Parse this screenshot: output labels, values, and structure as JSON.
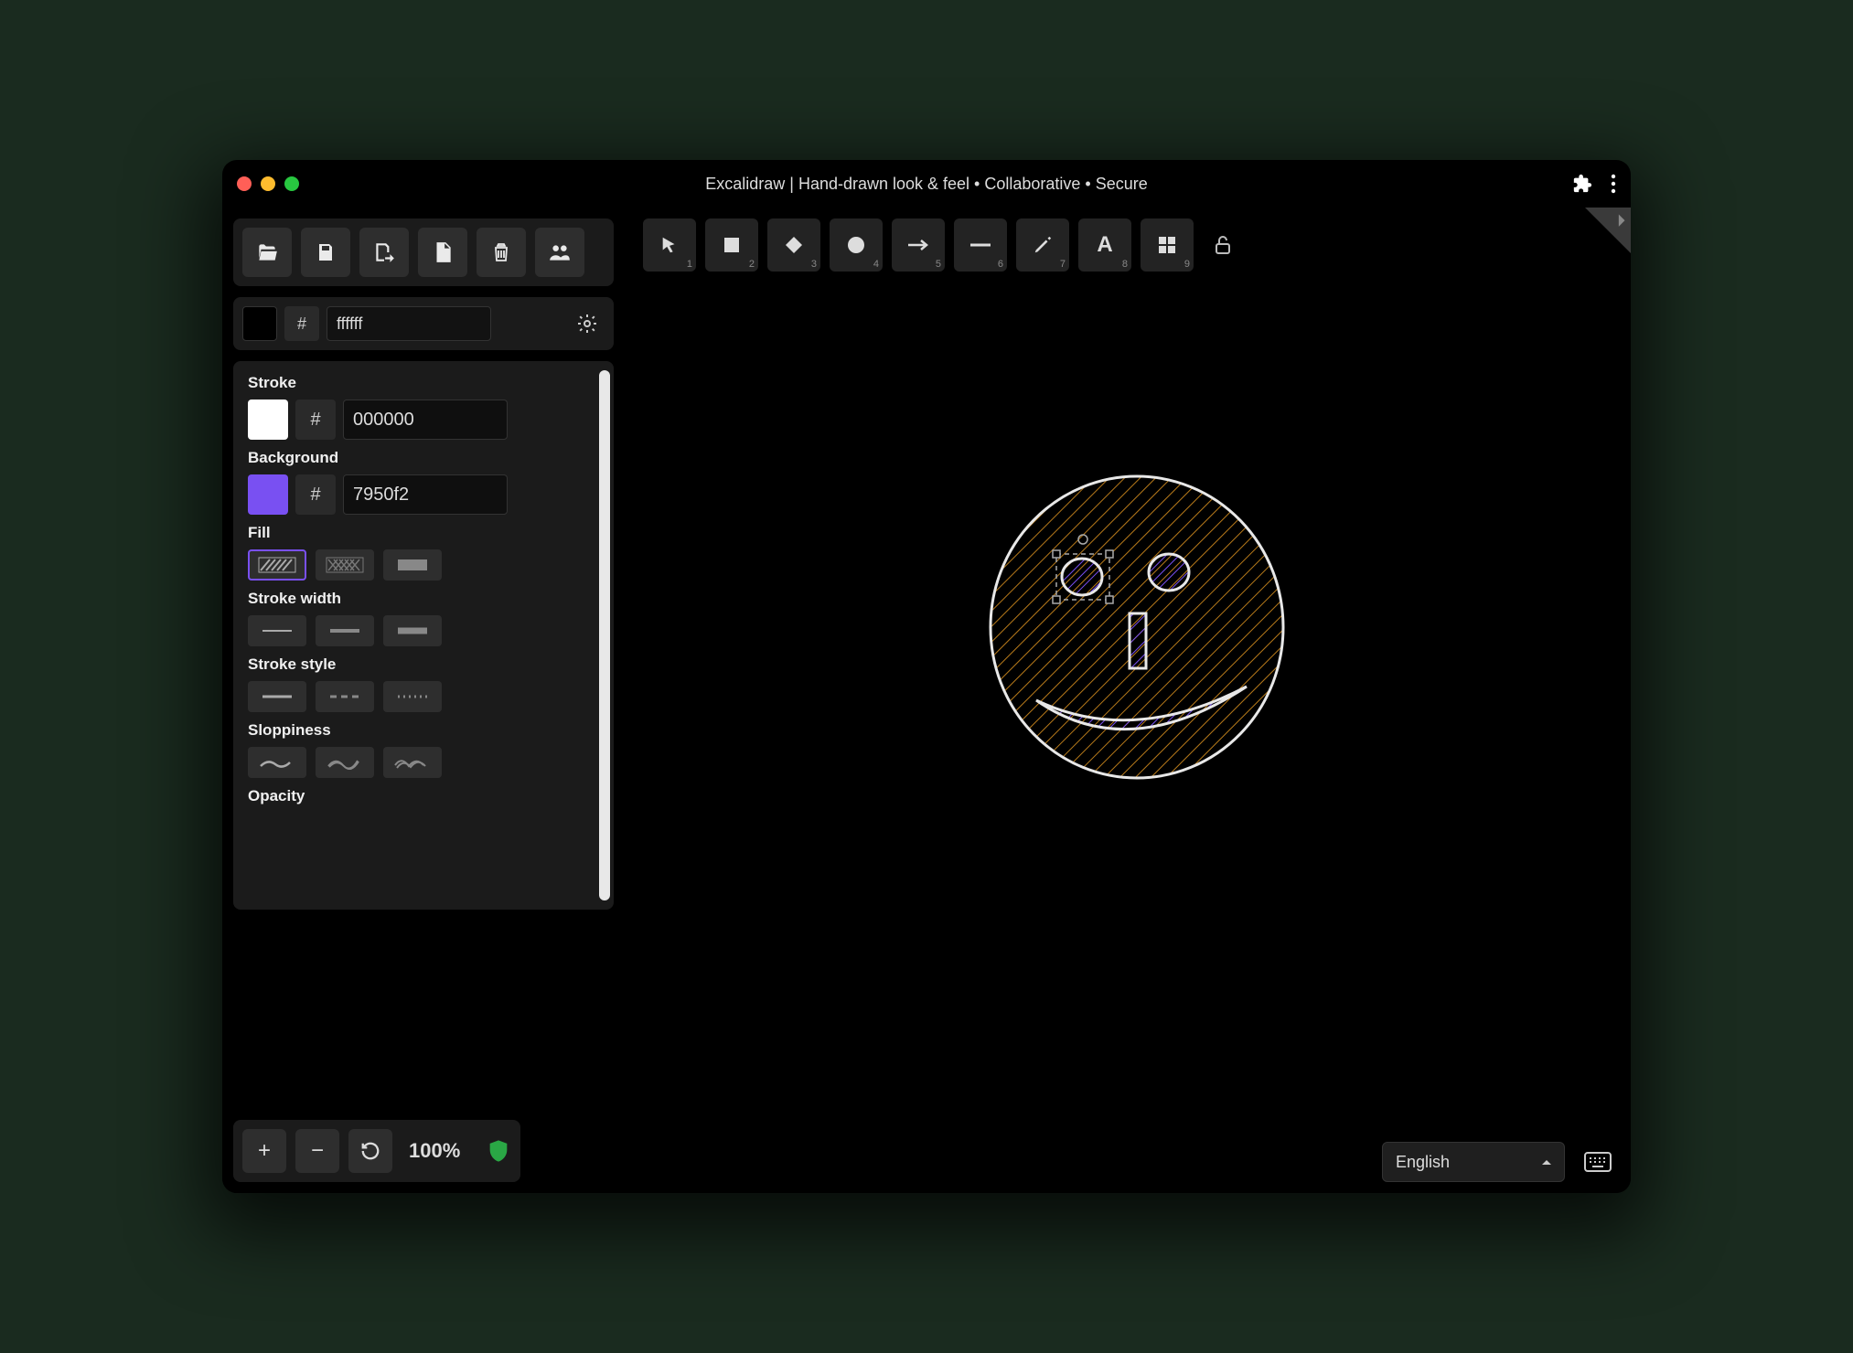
{
  "titlebar": {
    "title": "Excalidraw | Hand-drawn look & feel • Collaborative • Secure"
  },
  "canvas_color": {
    "hash": "#",
    "hex": "ffffff"
  },
  "tools": {
    "items": [
      {
        "name": "selection",
        "num": "1"
      },
      {
        "name": "rectangle",
        "num": "2"
      },
      {
        "name": "diamond",
        "num": "3"
      },
      {
        "name": "ellipse",
        "num": "4"
      },
      {
        "name": "arrow",
        "num": "5"
      },
      {
        "name": "line",
        "num": "6"
      },
      {
        "name": "draw",
        "num": "7"
      },
      {
        "name": "text",
        "num": "8"
      },
      {
        "name": "library",
        "num": "9"
      }
    ]
  },
  "props": {
    "stroke_label": "Stroke",
    "stroke": {
      "hash": "#",
      "hex": "000000",
      "swatch": "#ffffff"
    },
    "background_label": "Background",
    "background": {
      "hash": "#",
      "hex": "7950f2",
      "swatch": "#7950f2"
    },
    "fill_label": "Fill",
    "stroke_width_label": "Stroke width",
    "stroke_style_label": "Stroke style",
    "sloppiness_label": "Sloppiness",
    "opacity_label": "Opacity"
  },
  "zoom": {
    "label": "100%"
  },
  "language": {
    "selected": "English"
  }
}
